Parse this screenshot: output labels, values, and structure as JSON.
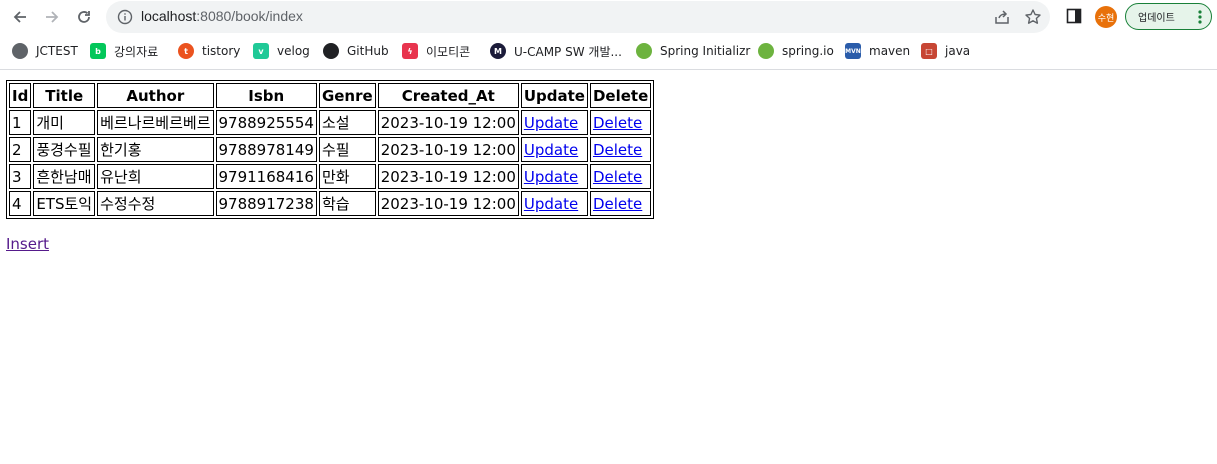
{
  "browser": {
    "url_host": "localhost",
    "url_rest": ":8080/book/index",
    "avatar_label": "수현",
    "update_label": "업데이트",
    "bookmarks": [
      {
        "label": "JCTEST",
        "icon": "globe-icon",
        "color": "#5f6368"
      },
      {
        "label": "강의자료",
        "icon": "blog-icon",
        "color": "#03c75a"
      },
      {
        "label": "tistory",
        "icon": "tistory-icon",
        "color": "#eb531f"
      },
      {
        "label": "velog",
        "icon": "velog-icon",
        "color": "#20c997"
      },
      {
        "label": "GitHub",
        "icon": "github-icon",
        "color": "#202124"
      },
      {
        "label": "이모티콘",
        "icon": "emoticon-icon",
        "color": "#e8344e"
      },
      {
        "label": "U-CAMP SW 개발...",
        "icon": "ucamp-icon",
        "color": "#1c1c3a"
      },
      {
        "label": "Spring Initializr",
        "icon": "spring-icon",
        "color": "#6db33f"
      },
      {
        "label": "spring.io",
        "icon": "spring-icon",
        "color": "#6db33f"
      },
      {
        "label": "maven",
        "icon": "maven-icon",
        "color": "#2a5caa"
      },
      {
        "label": "java",
        "icon": "java-icon",
        "color": "#c74634"
      }
    ]
  },
  "table": {
    "headers": [
      "Id",
      "Title",
      "Author",
      "Isbn",
      "Genre",
      "Created_At",
      "Update",
      "Delete"
    ],
    "rows": [
      {
        "id": "1",
        "title": "개미",
        "author": "베르나르베르베르",
        "isbn": "9788925554",
        "genre": "소설",
        "created_at": "2023-10-19 12:00",
        "update": "Update",
        "delete": "Delete"
      },
      {
        "id": "2",
        "title": "풍경수필",
        "author": "한기홍",
        "isbn": "9788978149",
        "genre": "수필",
        "created_at": "2023-10-19 12:00",
        "update": "Update",
        "delete": "Delete"
      },
      {
        "id": "3",
        "title": "흔한남매",
        "author": "유난희",
        "isbn": "9791168416",
        "genre": "만화",
        "created_at": "2023-10-19 12:00",
        "update": "Update",
        "delete": "Delete"
      },
      {
        "id": "4",
        "title": "ETS토익",
        "author": "수정수정",
        "isbn": "9788917238",
        "genre": "학습",
        "created_at": "2023-10-19 12:00",
        "update": "Update",
        "delete": "Delete"
      }
    ]
  },
  "insert_link": "Insert"
}
